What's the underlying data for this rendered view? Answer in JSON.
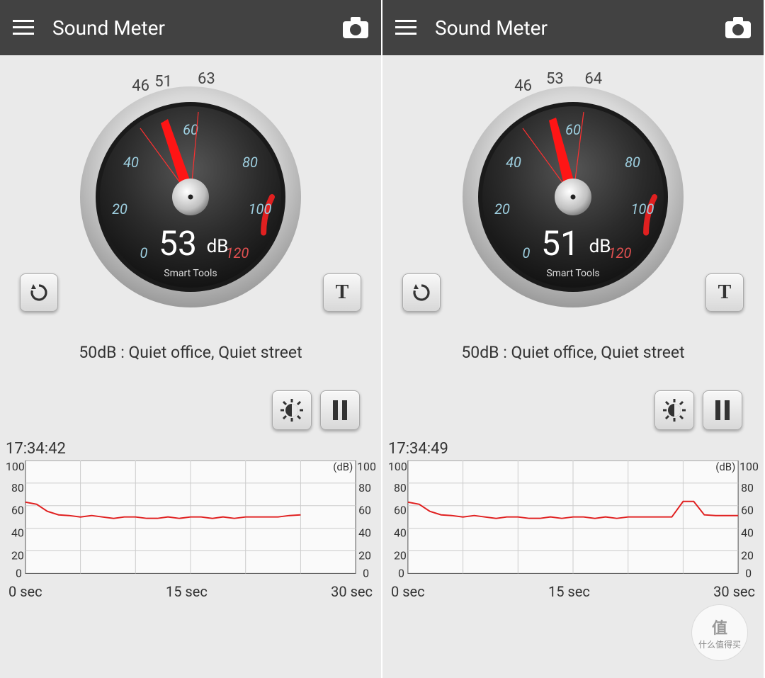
{
  "panels": [
    {
      "title": "Sound Meter",
      "gauge": {
        "reading": 53,
        "unit": "dB",
        "brand": "Smart Tools",
        "ticks": [
          0,
          20,
          40,
          60,
          80,
          100,
          120
        ],
        "pointer_min": 46,
        "pointer_cur": 51,
        "pointer_max": 63
      },
      "buttons": {
        "reset": "↻",
        "text": "T"
      },
      "description": "50dB : Quiet office, Quiet street",
      "timestamp": "17:34:42",
      "chart": {
        "y_ticks": [
          0,
          20,
          40,
          60,
          80,
          100
        ],
        "y_unit": "(dB)",
        "x_ticks": [
          "0 sec",
          "15 sec",
          "30 sec"
        ]
      }
    },
    {
      "title": "Sound Meter",
      "gauge": {
        "reading": 51,
        "unit": "dB",
        "brand": "Smart Tools",
        "ticks": [
          0,
          20,
          40,
          60,
          80,
          100,
          120
        ],
        "pointer_min": 46,
        "pointer_cur": 53,
        "pointer_max": 64
      },
      "buttons": {
        "reset": "↻",
        "text": "T"
      },
      "description": "50dB : Quiet office, Quiet street",
      "timestamp": "17:34:49",
      "chart": {
        "y_ticks": [
          0,
          20,
          40,
          60,
          80,
          100
        ],
        "y_unit": "(dB)",
        "x_ticks": [
          "0 sec",
          "15 sec",
          "30 sec"
        ]
      }
    }
  ],
  "chart_data": [
    {
      "type": "line",
      "title": "Sound level over time (left)",
      "xlabel": "sec",
      "ylabel": "dB",
      "xlim": [
        0,
        30
      ],
      "ylim": [
        0,
        100
      ],
      "x": [
        0,
        1,
        2,
        3,
        4,
        5,
        6,
        7,
        8,
        9,
        10,
        11,
        12,
        13,
        14,
        15,
        16,
        17,
        18,
        19,
        20,
        21,
        22,
        23,
        24,
        25
      ],
      "values": [
        63,
        61,
        55,
        52,
        51,
        50,
        51,
        50,
        49,
        50,
        50,
        49,
        49,
        50,
        49,
        50,
        50,
        49,
        50,
        49,
        50,
        50,
        50,
        50,
        51,
        52
      ]
    },
    {
      "type": "line",
      "title": "Sound level over time (right)",
      "xlabel": "sec",
      "ylabel": "dB",
      "xlim": [
        0,
        30
      ],
      "ylim": [
        0,
        100
      ],
      "x": [
        0,
        1,
        2,
        3,
        4,
        5,
        6,
        7,
        8,
        9,
        10,
        11,
        12,
        13,
        14,
        15,
        16,
        17,
        18,
        19,
        20,
        21,
        22,
        23,
        24,
        25,
        26,
        27,
        28,
        29,
        30
      ],
      "values": [
        63,
        61,
        55,
        52,
        51,
        50,
        51,
        50,
        49,
        50,
        50,
        49,
        49,
        50,
        49,
        50,
        50,
        49,
        50,
        49,
        50,
        50,
        50,
        50,
        50,
        64,
        64,
        52,
        51,
        51,
        51
      ]
    }
  ],
  "watermark": {
    "char": "值",
    "text": "什么值得买"
  }
}
